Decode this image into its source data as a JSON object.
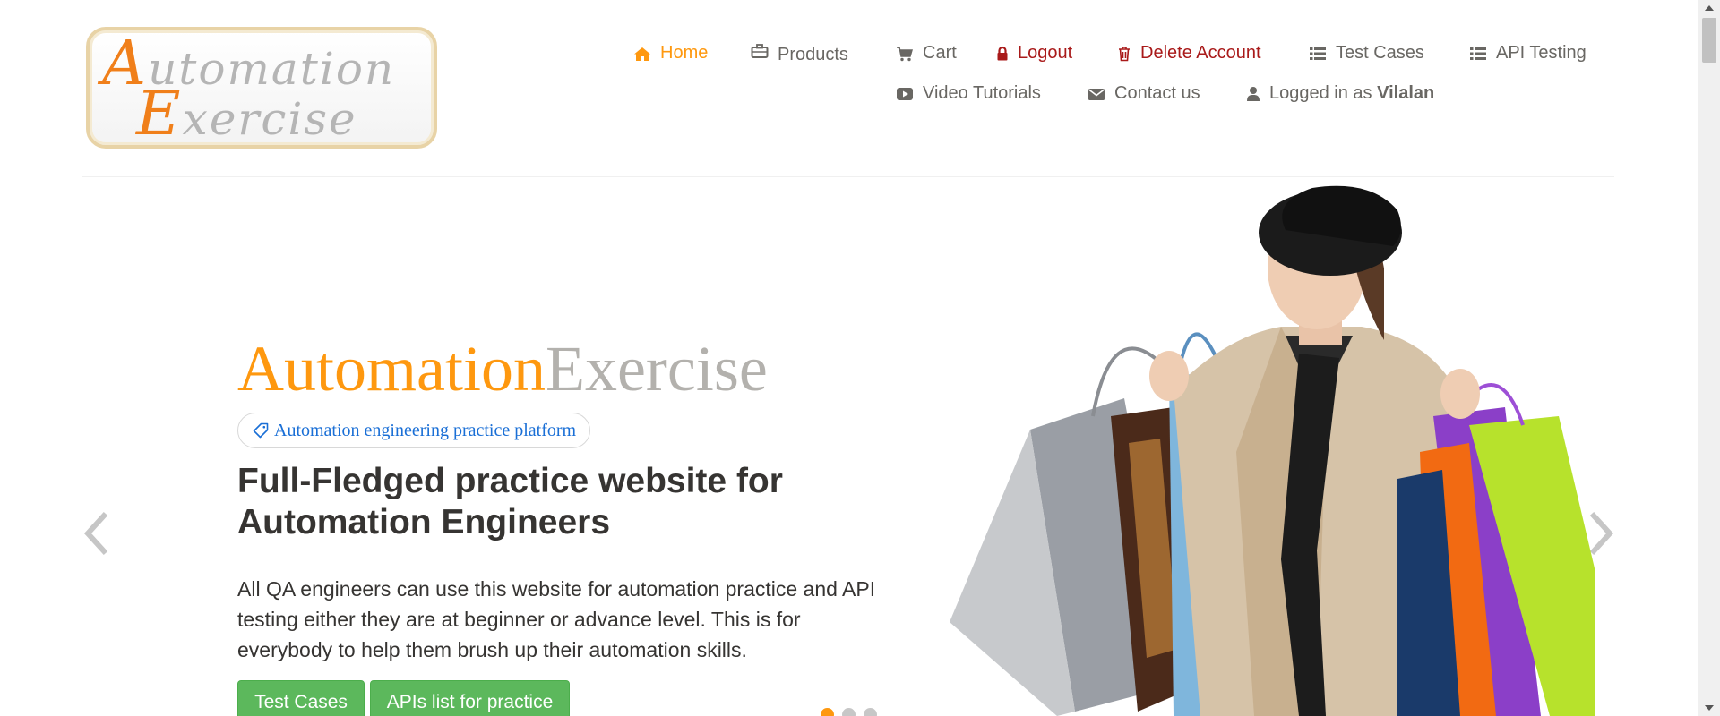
{
  "logo": {
    "line1_cap": "A",
    "line1_rest": "utomation",
    "line2_cap": "E",
    "line2_rest": "xercise"
  },
  "nav": {
    "home": "Home",
    "products": "Products",
    "cart": "Cart",
    "logout": "Logout",
    "delete_account": "Delete Account",
    "test_cases": "Test Cases",
    "api_testing": "API Testing",
    "video_tutorials": "Video Tutorials",
    "contact_us": "Contact us",
    "logged_in_prefix": "Logged in as",
    "username": "Vilalan"
  },
  "slider": {
    "brand_part1": "Automation",
    "brand_part2": "Exercise",
    "tag": "Automation engineering practice platform",
    "headline": "Full-Fledged practice website for Automation Engineers",
    "description": "All QA engineers can use this website for automation practice and API testing either they are at beginner or advance level. This is for everybody to help them brush up their automation skills.",
    "btn_test_cases": "Test Cases",
    "btn_apis": "APIs list for practice",
    "active_slide": 1,
    "slide_count": 3
  },
  "colors": {
    "accent": "#FE980F",
    "danger": "#A91A1A",
    "button": "#5CB85C",
    "text": "#696763",
    "heading": "#363432"
  },
  "icons": [
    "home-icon",
    "briefcase-icon",
    "cart-icon",
    "lock-icon",
    "trash-icon",
    "list-icon",
    "video-icon",
    "envelope-icon",
    "user-icon",
    "tag-icon",
    "chevron-left-icon",
    "chevron-right-icon"
  ]
}
